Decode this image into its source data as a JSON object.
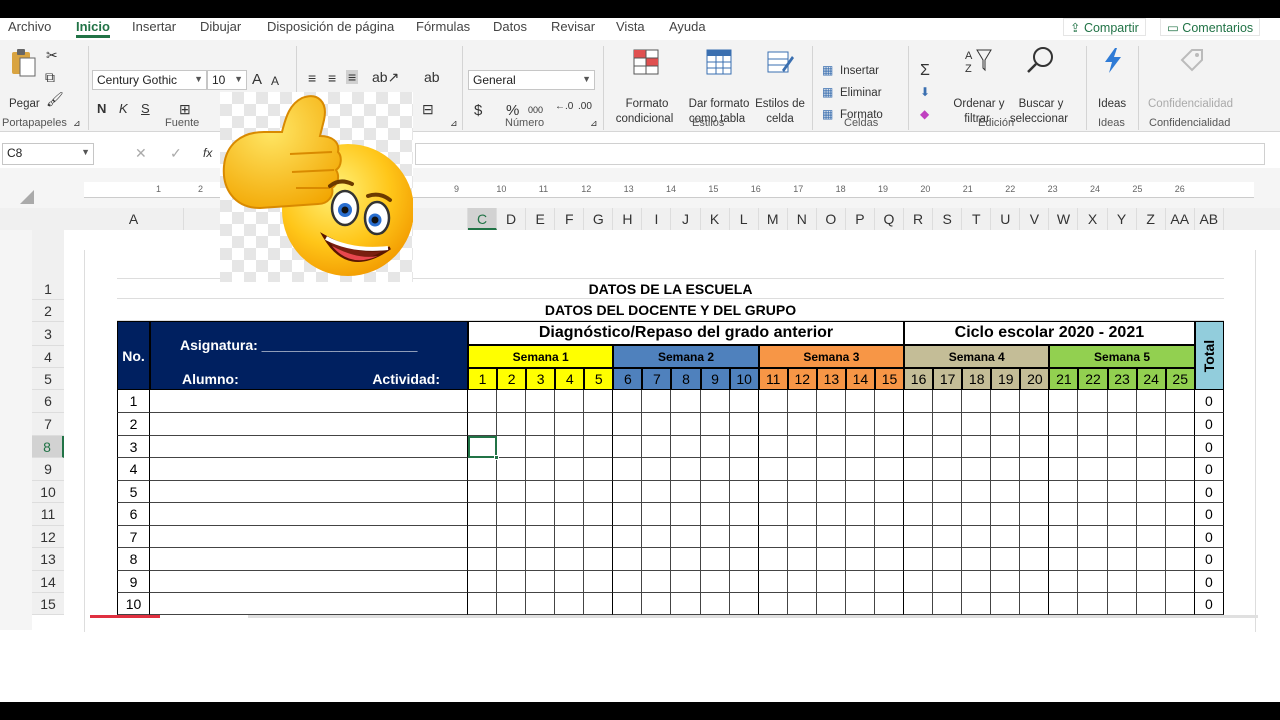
{
  "tabs": [
    "Archivo",
    "Inicio",
    "Insertar",
    "Dibujar",
    "Disposición de página",
    "Fórmulas",
    "Datos",
    "Revisar",
    "Vista",
    "Ayuda"
  ],
  "share_label": "Compartir",
  "comments_label": "Comentarios",
  "clipboard": {
    "paste_label": "Pegar",
    "group_label": "Portapapeles"
  },
  "font": {
    "name": "Century Gothic",
    "size": "10",
    "group_label": "Fuente",
    "bold": "N",
    "italic": "K",
    "underline": "S",
    "grow": "A",
    "shrink": "A",
    "color_a": "A"
  },
  "number": {
    "format": "General",
    "group_label": "Número",
    "currency": "$",
    "percent": "%",
    "thousands": "000"
  },
  "styles": {
    "conditional": [
      "Formato",
      "condicional"
    ],
    "table": [
      "Dar formato",
      "como tabla"
    ],
    "cell": [
      "Estilos de",
      "celda"
    ],
    "group_label": "Estilos"
  },
  "cells": {
    "insert": "Insertar",
    "delete": "Eliminar",
    "format": "Formato",
    "group_label": "Celdas"
  },
  "editing": {
    "sort": [
      "Ordenar y",
      "filtrar"
    ],
    "find": [
      "Buscar y",
      "seleccionar"
    ],
    "group_label": "Edición",
    "sum": "Σ"
  },
  "ideas": {
    "label": "Ideas",
    "group_label": "Ideas"
  },
  "sensitivity": {
    "label": "Confidencialidad",
    "group_label": "Confidencialidad"
  },
  "namebox": "C8",
  "fx": "fx",
  "ruler_numbers": [
    "1",
    "2",
    "9",
    "10",
    "11",
    "12",
    "13",
    "14",
    "15",
    "16",
    "17",
    "18",
    "19",
    "20",
    "21",
    "22",
    "23",
    "24",
    "25",
    "26"
  ],
  "columns": [
    "A",
    "B",
    "C",
    "D",
    "E",
    "F",
    "G",
    "H",
    "I",
    "J",
    "K",
    "L",
    "M",
    "N",
    "O",
    "P",
    "Q",
    "R",
    "S",
    "T",
    "U",
    "V",
    "W",
    "X",
    "Y",
    "Z",
    "AA",
    "AB"
  ],
  "rows": [
    "1",
    "2",
    "3",
    "4",
    "5",
    "6",
    "7",
    "8",
    "9",
    "10",
    "11",
    "12",
    "13",
    "14",
    "15"
  ],
  "sheet": {
    "title1": "DATOS DE LA ESCUELA",
    "title2": "DATOS DEL DOCENTE Y DEL GRUPO",
    "no_label": "No.",
    "asignatura_label": "Asignatura: ____________________",
    "alumno_label": "Alumno:",
    "actividad_label": "Actividad:",
    "diagnostico_label": "Diagnóstico/Repaso del grado anterior",
    "ciclo_label": "Ciclo escolar 2020 - 2021",
    "total_label": "Total",
    "weeks": [
      {
        "label": "Semana 1",
        "color": "#ffff00"
      },
      {
        "label": "Semana 2",
        "color": "#4f81bd"
      },
      {
        "label": "Semana 3",
        "color": "#f79646"
      },
      {
        "label": "Semana 4",
        "color": "#c4bd97"
      },
      {
        "label": "Semana 5",
        "color": "#92d050"
      }
    ],
    "day_numbers": [
      "1",
      "2",
      "3",
      "4",
      "5",
      "6",
      "7",
      "8",
      "9",
      "10",
      "11",
      "12",
      "13",
      "14",
      "15",
      "16",
      "17",
      "18",
      "19",
      "20",
      "21",
      "22",
      "23",
      "24",
      "25"
    ],
    "student_numbers": [
      "1",
      "2",
      "3",
      "4",
      "5",
      "6",
      "7",
      "8",
      "9",
      "10"
    ],
    "totals": [
      "0",
      "0",
      "0",
      "0",
      "0",
      "0",
      "0",
      "0",
      "0",
      "0"
    ],
    "header_color": "#002060",
    "total_color": "#92cddc"
  },
  "accent_color": "#217346"
}
